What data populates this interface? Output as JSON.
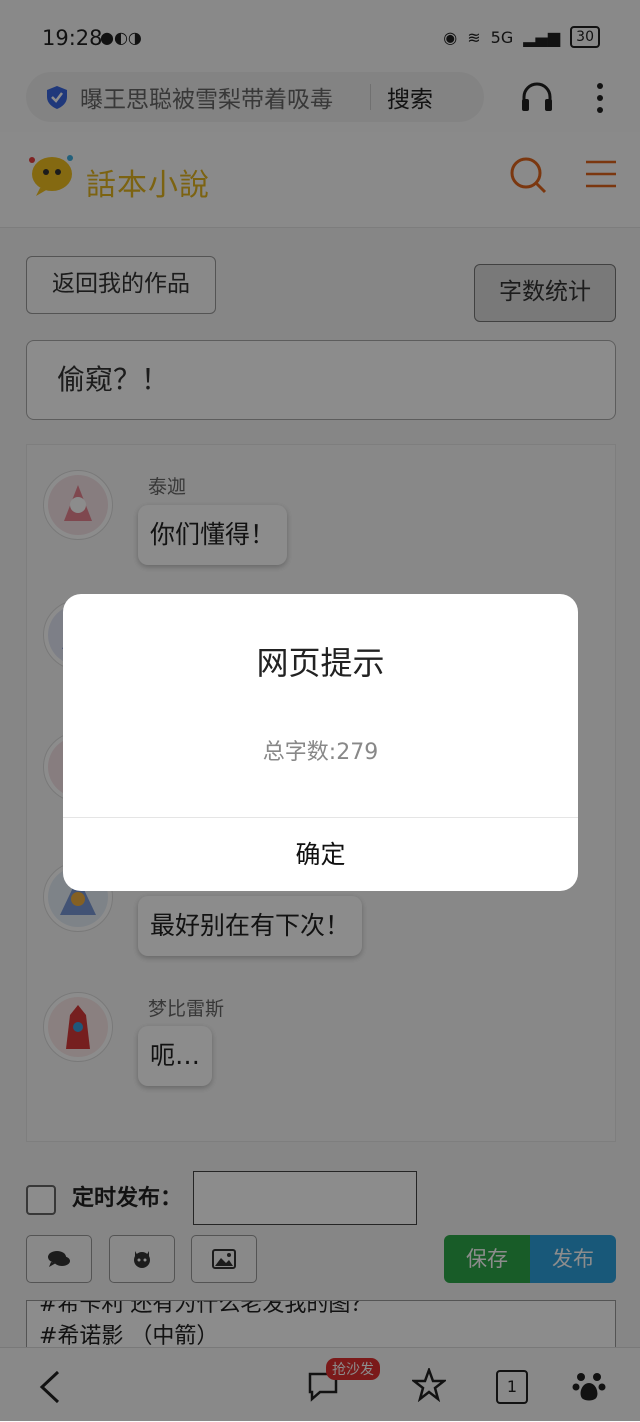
{
  "status_bar": {
    "time": "19:28",
    "network": "5G",
    "battery": "30"
  },
  "browser": {
    "search_text": "曝王思聪被雪梨带着吸毒",
    "search_button": "搜索"
  },
  "site": {
    "logo_text": "話本小說"
  },
  "page": {
    "back_button": "返回我的作品",
    "count_button": "字数统计",
    "title_value": "偷窥？！"
  },
  "chat": {
    "messages": [
      {
        "speaker": "泰迦",
        "text": "你们懂得！"
      },
      {
        "speaker": "",
        "text": "最好别在有下次！"
      },
      {
        "speaker": "梦比雷斯",
        "text": "呃…"
      }
    ]
  },
  "controls": {
    "timer_label": "定时发布：",
    "save_label": "保存",
    "publish_label": "发布"
  },
  "editor": {
    "line1": "#希卡利 还有为什么老发我的图？",
    "line2": "#希诺影 （中箭）"
  },
  "bottom_nav": {
    "sofa_badge": "抢沙发",
    "tab_count": "1"
  },
  "dialog": {
    "title": "网页提示",
    "message": "总字数:279",
    "confirm": "确定"
  }
}
